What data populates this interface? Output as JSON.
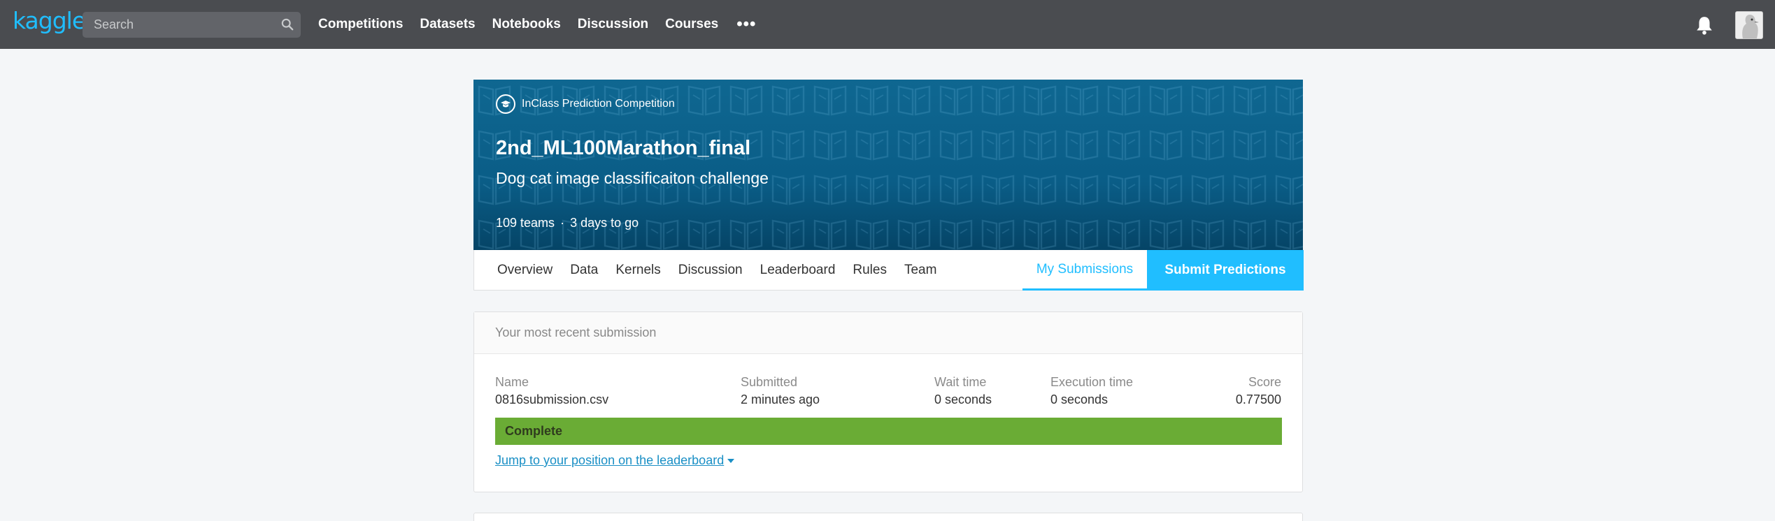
{
  "nav": {
    "logo": "kaggle",
    "search_placeholder": "Search",
    "links": [
      "Competitions",
      "Datasets",
      "Notebooks",
      "Discussion",
      "Courses"
    ],
    "more": "•••"
  },
  "banner": {
    "type": "InClass Prediction Competition",
    "title": "2nd_ML100Marathon_final",
    "subtitle": "Dog cat image classificaiton challenge",
    "teams": "109 teams",
    "separator": "·",
    "time_left": "3 days to go"
  },
  "tabs": {
    "items": [
      "Overview",
      "Data",
      "Kernels",
      "Discussion",
      "Leaderboard",
      "Rules",
      "Team"
    ],
    "my_submissions": "My Submissions",
    "submit": "Submit Predictions"
  },
  "submission": {
    "header": "Your most recent submission",
    "name_label": "Name",
    "name": "0816submission.csv",
    "submitted_label": "Submitted",
    "submitted": "2 minutes ago",
    "wait_label": "Wait time",
    "wait": "0 seconds",
    "exec_label": "Execution time",
    "exec": "0 seconds",
    "score_label": "Score",
    "score": "0.77500",
    "status": "Complete",
    "jump_link": "Jump to your position on the leaderboard"
  },
  "colors": {
    "nav_bg": "#4a4c50",
    "accent": "#20beff",
    "banner": "#0a5d87",
    "complete": "#6aac35"
  }
}
